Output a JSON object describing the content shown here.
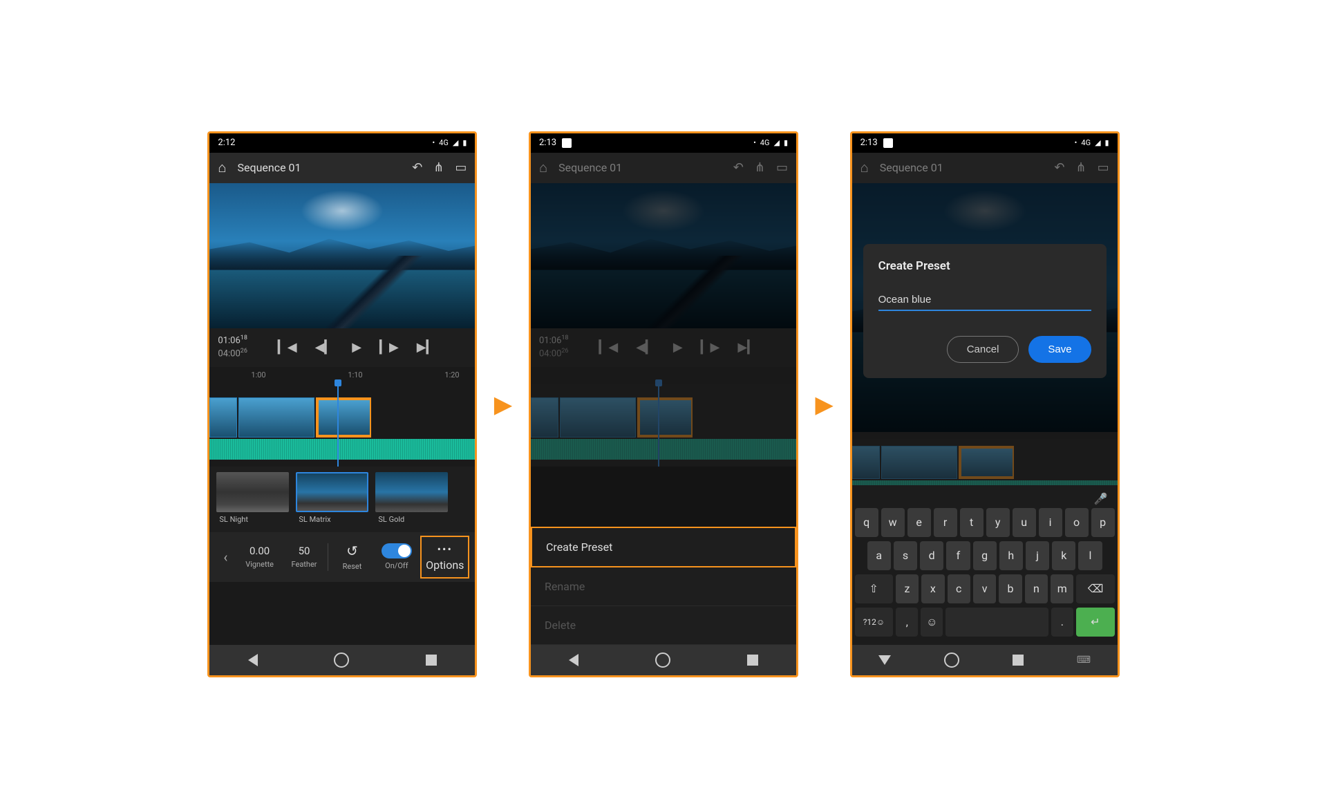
{
  "screens": [
    {
      "status": {
        "time": "2:12",
        "network": "4G"
      },
      "header": {
        "title": "Sequence 01"
      },
      "timecode": {
        "current": "01:06",
        "current_frames": "18",
        "total": "04:00",
        "total_frames": "26"
      },
      "ruler": {
        "t1": "1:00",
        "t2": "1:10",
        "t3": "1:20"
      },
      "presets": [
        {
          "label": "SL Night"
        },
        {
          "label": "SL Matrix"
        },
        {
          "label": "SL Gold"
        }
      ],
      "controls": {
        "vignette_val": "0.00",
        "vignette_label": "Vignette",
        "feather_val": "50",
        "feather_label": "Feather",
        "reset_label": "Reset",
        "onoff_label": "On/Off",
        "options_label": "Options"
      }
    },
    {
      "status": {
        "time": "2:13",
        "network": "4G"
      },
      "header": {
        "title": "Sequence 01"
      },
      "timecode": {
        "current": "01:06",
        "current_frames": "18",
        "total": "04:00",
        "total_frames": "26"
      },
      "menu": {
        "create": "Create Preset",
        "rename": "Rename",
        "delete": "Delete"
      }
    },
    {
      "status": {
        "time": "2:13",
        "network": "4G"
      },
      "header": {
        "title": "Sequence 01"
      },
      "dialog": {
        "title": "Create Preset",
        "input_value": "Ocean blue",
        "cancel": "Cancel",
        "save": "Save"
      },
      "keyboard": {
        "row1": [
          "q",
          "w",
          "e",
          "r",
          "t",
          "y",
          "u",
          "i",
          "o",
          "p"
        ],
        "row2": [
          "a",
          "s",
          "d",
          "f",
          "g",
          "h",
          "j",
          "k",
          "l"
        ],
        "row3": [
          "z",
          "x",
          "c",
          "v",
          "b",
          "n",
          "m"
        ],
        "numkey": "?12☺",
        "comma": ",",
        "period": "."
      }
    }
  ]
}
